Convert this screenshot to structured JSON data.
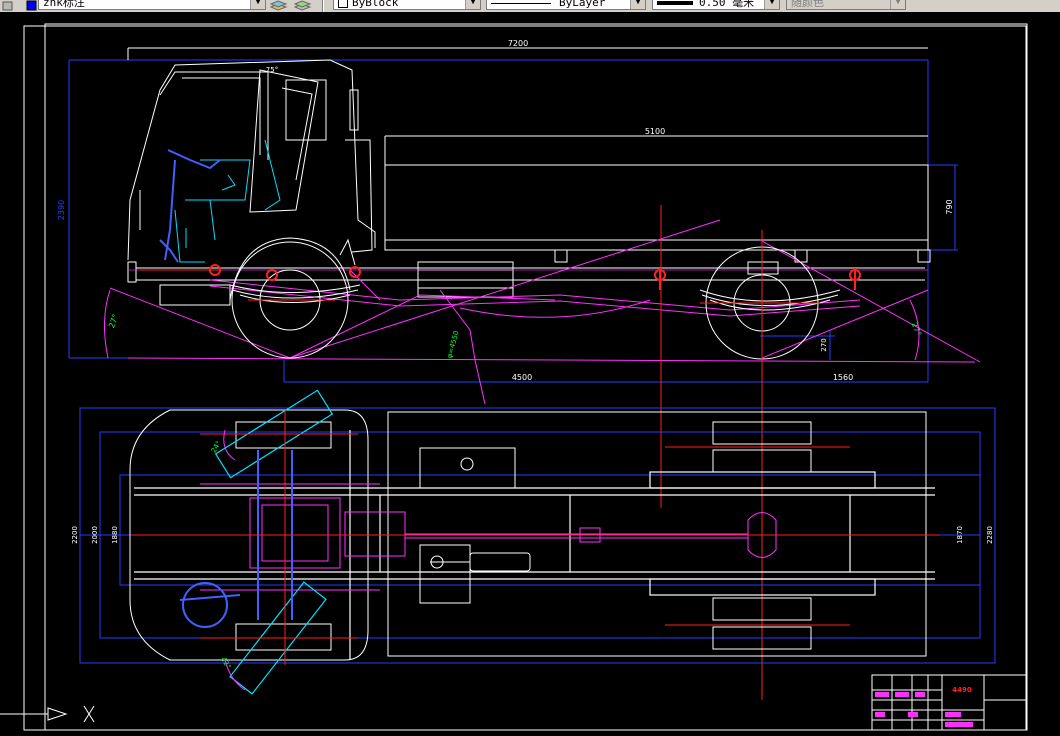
{
  "toolbar": {
    "text_style": "zhk标注",
    "linetype_current": "ByBlock",
    "linetype_layer": "ByLayer",
    "lineweight": "0.50 毫米",
    "plot_style": "随颜色"
  },
  "drawing": {
    "dims": {
      "overall_length": "7200",
      "body_length": "5100",
      "overall_height": "2390",
      "body_height": "790",
      "wheelbase": "4500",
      "rear_overhang": "1560",
      "ground_clearance": "270",
      "approach_angle": "27°",
      "departure_angle": "27°",
      "break_angle": "φ=4550",
      "cab_tilt": "75°",
      "steer_angle_top": "24°",
      "steer_angle_bottom": "42°",
      "width_outer": "2200",
      "width_frame": "2280",
      "width_track": "1870",
      "width_inner": "1880",
      "width_left": "2000"
    },
    "title_block": {
      "title": "4490"
    }
  }
}
